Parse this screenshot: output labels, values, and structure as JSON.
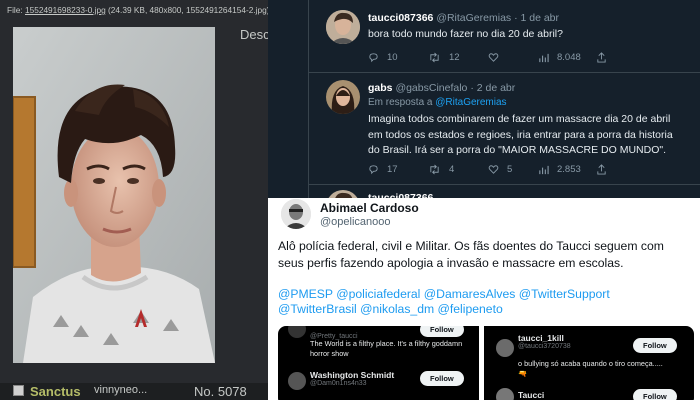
{
  "board": {
    "file_label": "File: ",
    "file_link": "1552491698233-0.jpg",
    "file_meta": " (24.39 KB, 480x800, 1552491264154-2.jpg)",
    "side_text": "Desc",
    "poster_name": "Sanctus",
    "poster_meta": "vinnyneo...",
    "post_number": "No. 5078"
  },
  "thread": {
    "tweets": [
      {
        "name": "taucci087366",
        "handle": "@RitaGeremias",
        "time": "· 1 de abr",
        "text_lines": [
          "bora todo mundo fazer no  dia 20 de abril?"
        ],
        "replies": "10",
        "retweets": "12",
        "likes": "8.048"
      },
      {
        "name": "gabs",
        "handle": "@gabsCinefalo",
        "time": "· 2 de abr",
        "reply_prefix": "Em resposta a ",
        "reply_to": "@RitaGeremias",
        "text_lines": [
          "Imagina  todos combinarem de fazer um massacre dia 20 de abril",
          "em todos os estados e regioes, iria entrar para a porra da historia",
          "do Brasil. Irá ser a porra do \"MAIOR MASSACRE DO MUNDO\"."
        ],
        "replies": "17",
        "retweets": "4",
        "likes": "5",
        "views": "2.853"
      },
      {
        "name": "taucci087366"
      }
    ]
  },
  "card": {
    "name": "Abimael Cardoso",
    "handle": "@opelicanooo",
    "body_lines": [
      "Alô polícia federal, civil e Militar. Os fãs doentes do Taucci seguem com",
      "seus perfis fazendo apologia a invasão e massacre em escolas."
    ],
    "tag_lines": [
      "@PMESP @policiafederal @DamaresAlves  @TwitterSupport",
      "@TwitterBrasil @nikolas_dm @felipeneto"
    ],
    "embed_left": {
      "top_handle": "@Pretty_taucci",
      "text_lines": [
        "The World is a filthy place. It's a filthy goddamn",
        "horror show"
      ],
      "user_name": "Washington Schmidt",
      "user_handle": "@Dam0n1ns4n33",
      "follow_label": "Follow"
    },
    "embed_right": {
      "user_name": "taucci_1kill",
      "user_handle": "@taucci3720738",
      "follow_label": "Follow",
      "text_lines": [
        "o bullying só acaba quando o tiro começa.....",
        "🔫"
      ],
      "second_name": "Taucci",
      "second_follow_label": "Follow"
    }
  },
  "colors": {
    "board_bg": "#282a2e",
    "thread_bg": "#15202b",
    "link_blue": "#1da1f2",
    "card_link": "#1d9bf0"
  }
}
